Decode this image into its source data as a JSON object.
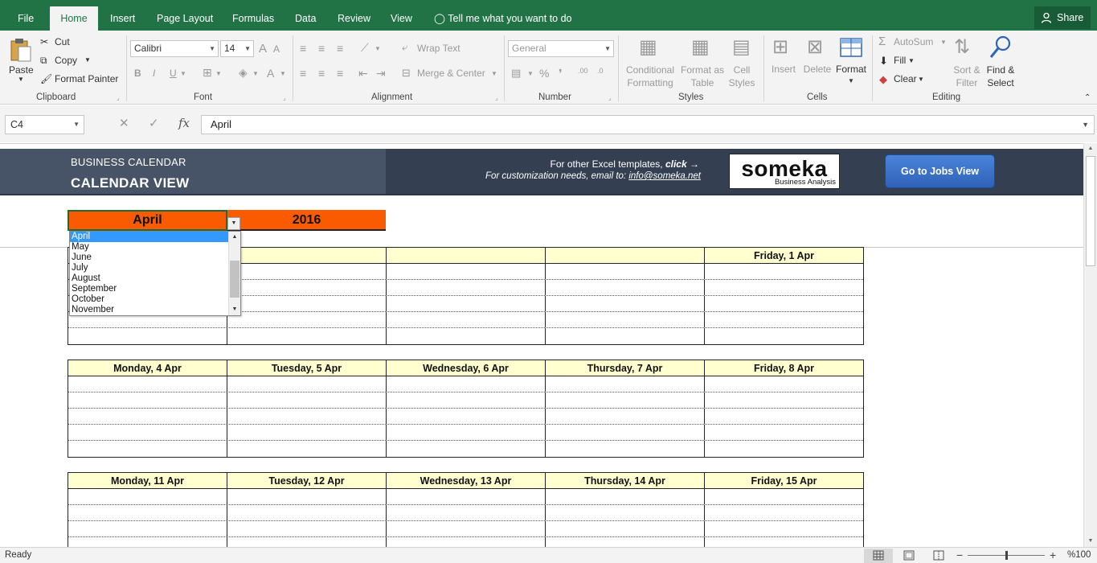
{
  "tabs": [
    "File",
    "Home",
    "Insert",
    "Page Layout",
    "Formulas",
    "Data",
    "Review",
    "View"
  ],
  "tell_me": "Tell me what you want to do",
  "share": "Share",
  "ribbon": {
    "clipboard": {
      "paste": "Paste",
      "cut": "Cut",
      "copy": "Copy",
      "format_painter": "Format Painter",
      "label": "Clipboard"
    },
    "font": {
      "family": "Calibri",
      "size": "14",
      "bold": "B",
      "italic": "I",
      "underline": "U",
      "font_color": "A",
      "label": "Font"
    },
    "alignment": {
      "wrap_text": "Wrap Text",
      "merge_center": "Merge & Center",
      "label": "Alignment"
    },
    "number": {
      "format": "General",
      "percent": "%",
      "label": "Number"
    },
    "styles": {
      "conditional_formatting": [
        "Conditional",
        "Formatting"
      ],
      "format_as_table": [
        "Format as",
        "Table"
      ],
      "cell_styles": [
        "Cell",
        "Styles"
      ],
      "label": "Styles"
    },
    "cells": {
      "insert": "Insert",
      "delete": "Delete",
      "format": "Format",
      "label": "Cells"
    },
    "editing": {
      "autosum": "AutoSum",
      "fill": "Fill",
      "clear": "Clear",
      "sort_filter": [
        "Sort &",
        "Filter"
      ],
      "find_select": [
        "Find &",
        "Select"
      ],
      "label": "Editing"
    }
  },
  "formula_bar": {
    "name_box": "C4",
    "fx": "fx",
    "value": "April"
  },
  "banner": {
    "subtitle": "BUSINESS CALENDAR",
    "title": "CALENDAR VIEW",
    "note1": "For other Excel templates,",
    "note1_link": "click",
    "note2": "For customization needs, email to:",
    "email": "info@someka.net",
    "logo_word": "someka",
    "logo_sub": "Business Analysis",
    "jobs_button": "Go to Jobs View"
  },
  "selector": {
    "month": "April",
    "year": "2016"
  },
  "dropdown": {
    "options": [
      "April",
      "May",
      "June",
      "July",
      "August",
      "September",
      "October",
      "November"
    ],
    "selected": "April"
  },
  "weeks": [
    {
      "days": [
        "",
        "",
        "",
        "",
        "Friday, 1 Apr"
      ]
    },
    {
      "days": [
        "Monday, 4 Apr",
        "Tuesday, 5 Apr",
        "Wednesday, 6 Apr",
        "Thursday, 7 Apr",
        "Friday, 8 Apr"
      ]
    },
    {
      "days": [
        "Monday, 11 Apr",
        "Tuesday, 12 Apr",
        "Wednesday, 13 Apr",
        "Thursday, 14 Apr",
        "Friday, 15 Apr"
      ]
    }
  ],
  "status": {
    "text": "Ready",
    "zoom": "%100",
    "minus": "−",
    "plus": "+"
  },
  "colors": {
    "excel_green": "#217346",
    "banner_dark": "#344052",
    "banner_mid": "#475366",
    "orange": "#fa5a00",
    "header_yellow": "#ffffd0",
    "button_blue": "#2f62b8"
  }
}
